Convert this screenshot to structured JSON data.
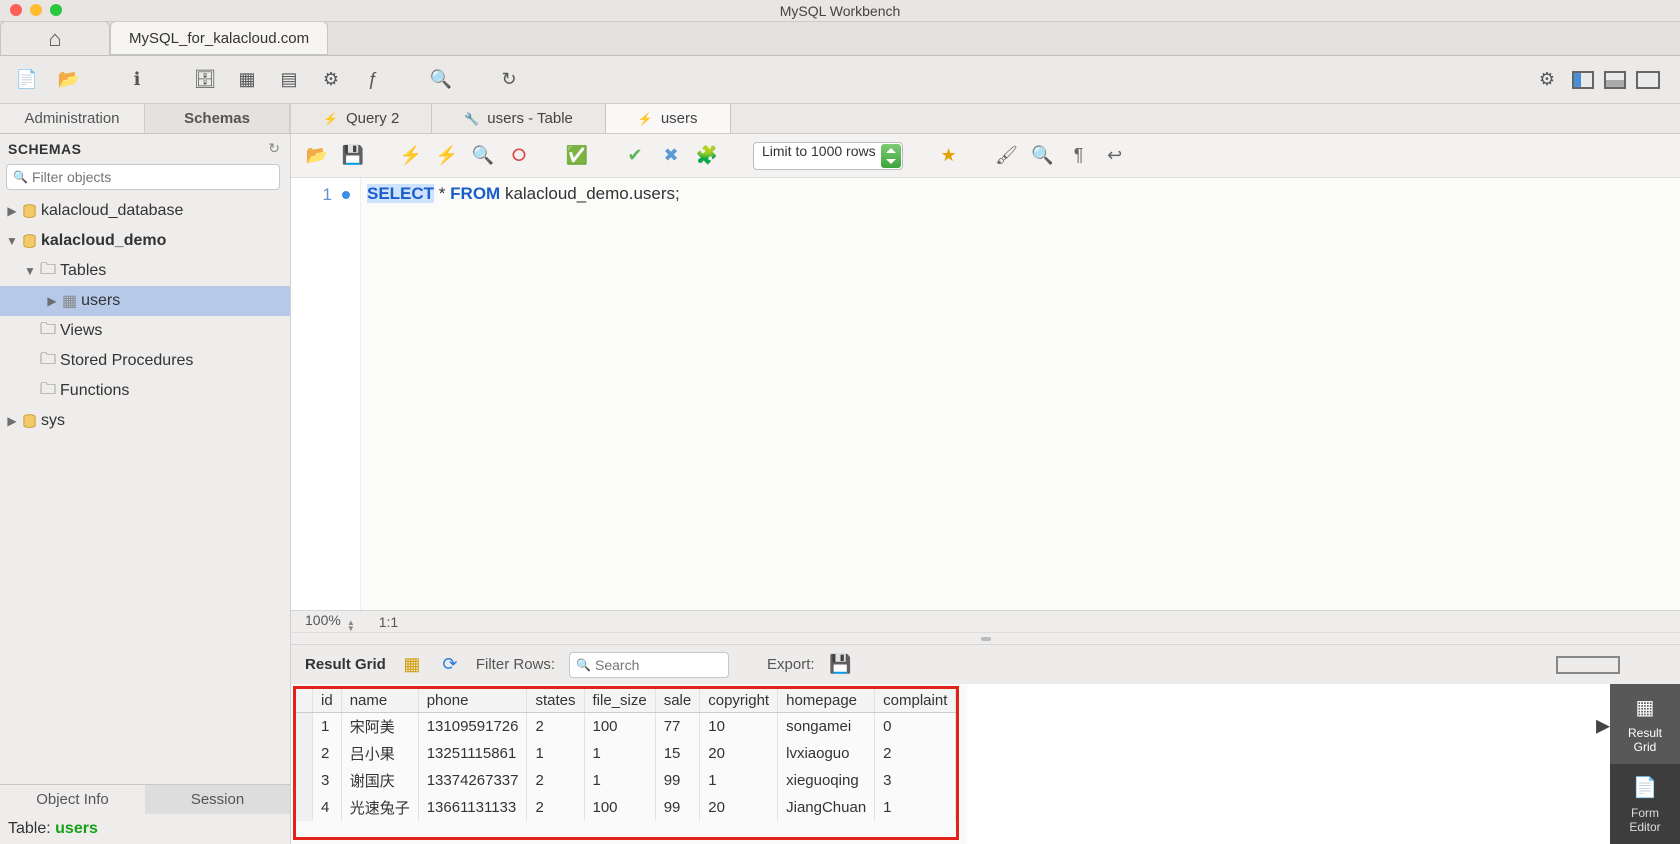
{
  "window": {
    "title": "MySQL Workbench"
  },
  "appTabs": {
    "connection": "MySQL_for_kalacloud.com"
  },
  "sidebar": {
    "tabs": {
      "admin": "Administration",
      "schemas": "Schemas"
    },
    "header": "SCHEMAS",
    "filter_placeholder": "Filter objects",
    "items": {
      "db1": "kalacloud_database",
      "db2": "kalacloud_demo",
      "tables": "Tables",
      "users": "users",
      "views": "Views",
      "sproc": "Stored Procedures",
      "funcs": "Functions",
      "sys": "sys"
    },
    "bottomTabs": {
      "objinfo": "Object Info",
      "session": "Session"
    },
    "statusLabel": "Table:",
    "statusValue": "users"
  },
  "editorTabs": {
    "t1": "Query 2",
    "t2": "users - Table",
    "t3": "users"
  },
  "editorToolbar": {
    "limit": "Limit to 1000 rows"
  },
  "sql": {
    "line_no": "1",
    "kw1": "SELECT",
    "star": "*",
    "kw2": "FROM",
    "rest": "kalacloud_demo.users;"
  },
  "editorStatus": {
    "zoom": "100%",
    "pos": "1:1"
  },
  "resultBar": {
    "title": "Result Grid",
    "filterLabel": "Filter Rows:",
    "searchPlaceholder": "Search",
    "exportLabel": "Export:"
  },
  "grid": {
    "columns": [
      "id",
      "name",
      "phone",
      "states",
      "file_size",
      "sale",
      "copyright",
      "homepage",
      "complaint"
    ],
    "rows": [
      [
        "1",
        "宋阿美",
        "13109591726",
        "2",
        "100",
        "77",
        "10",
        "songamei",
        "0"
      ],
      [
        "2",
        "吕小果",
        "13251115861",
        "1",
        "1",
        "15",
        "20",
        "lvxiaoguo",
        "2"
      ],
      [
        "3",
        "谢国庆",
        "13374267337",
        "2",
        "1",
        "99",
        "1",
        "xieguoqing",
        "3"
      ],
      [
        "4",
        "光速兔子",
        "13661131133",
        "2",
        "100",
        "99",
        "20",
        "JiangChuan",
        "1"
      ]
    ]
  },
  "sideResultTabs": {
    "grid": "Result\nGrid",
    "form": "Form\nEditor"
  }
}
